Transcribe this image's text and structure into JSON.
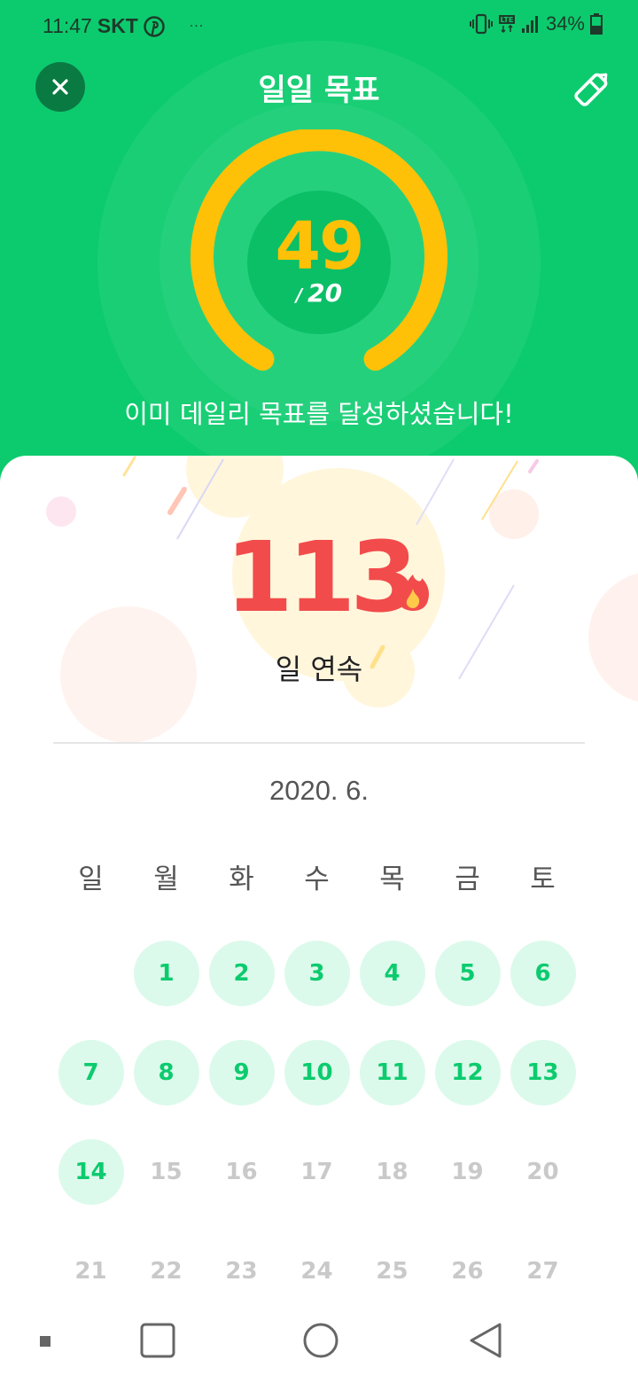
{
  "status_bar": {
    "time": "11:47",
    "carrier": "SKT",
    "dots": "···",
    "battery_percent": "34%",
    "icons": [
      "pinterest-icon",
      "vibrate-icon",
      "lte-icon",
      "signal-icon",
      "battery-icon"
    ]
  },
  "header": {
    "title": "일일 목표",
    "close_icon": "close-icon",
    "edit_icon": "pencil-icon"
  },
  "progress": {
    "count": "49",
    "slash": "/",
    "goal": "20",
    "message": "이미 데일리 목표를 달성하셨습니다!",
    "fill_fraction": 1.0
  },
  "streak": {
    "days": "113",
    "label": "일 연속",
    "icon": "fire-icon"
  },
  "calendar": {
    "month": "2020. 6.",
    "weekdays": [
      "일",
      "월",
      "화",
      "수",
      "목",
      "금",
      "토"
    ],
    "weeks": [
      [
        "",
        "1",
        "2",
        "3",
        "4",
        "5",
        "6"
      ],
      [
        "7",
        "8",
        "9",
        "10",
        "11",
        "12",
        "13"
      ],
      [
        "14",
        "15",
        "16",
        "17",
        "18",
        "19",
        "20"
      ],
      [
        "21",
        "22",
        "23",
        "24",
        "25",
        "26",
        "27"
      ]
    ],
    "completed_days": [
      "1",
      "2",
      "3",
      "4",
      "5",
      "6",
      "7",
      "8",
      "9",
      "10",
      "11",
      "12",
      "13",
      "14"
    ]
  },
  "colors": {
    "brand_green": "#0ccb6e",
    "ring_yellow": "#ffc107",
    "streak_red": "#f24b4b",
    "done_bg": "#dcfaeb"
  },
  "navbar": {
    "icons": [
      "recent-dot-icon",
      "overview-square-icon",
      "home-circle-icon",
      "back-triangle-icon"
    ]
  }
}
